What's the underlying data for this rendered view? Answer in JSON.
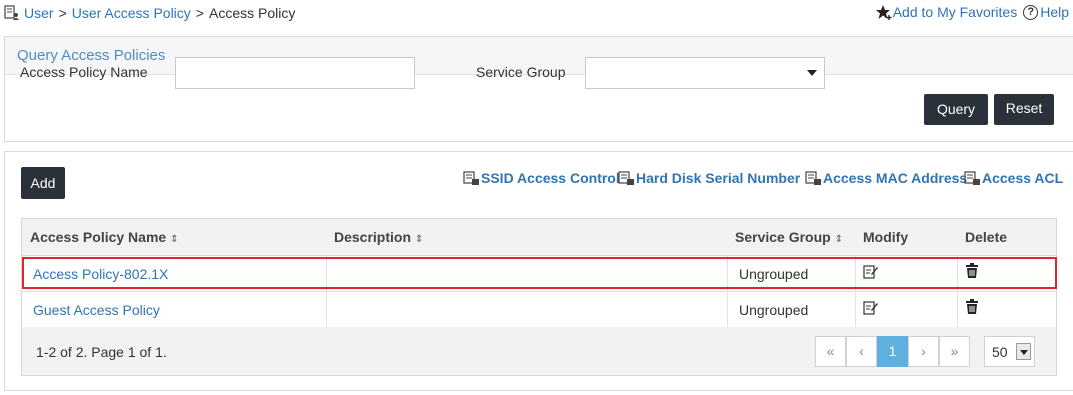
{
  "breadcrumb": {
    "items": [
      "User",
      "User Access Policy",
      "Access Policy"
    ],
    "separator": ">"
  },
  "toplinks": {
    "favorites": "Add to My Favorites",
    "help": "Help"
  },
  "query": {
    "title": "Query Access Policies",
    "name_label": "Access Policy Name",
    "name_value": "",
    "group_label": "Service Group",
    "group_value": "",
    "query_button": "Query",
    "reset_button": "Reset"
  },
  "toolbar": {
    "add_button": "Add",
    "links": [
      "SSID Access Control",
      "Hard Disk Serial Number",
      "Access MAC Address",
      "Access ACL"
    ]
  },
  "table": {
    "columns": [
      "Access Policy Name",
      "Description",
      "Service Group",
      "Modify",
      "Delete"
    ],
    "sort_glyph": "⇕",
    "rows": [
      {
        "name": "Access Policy-802.1X",
        "description": "",
        "service_group": "Ungrouped"
      },
      {
        "name": "Guest Access Policy",
        "description": "",
        "service_group": "Ungrouped"
      }
    ]
  },
  "pagination": {
    "info": "1-2 of 2. Page 1 of 1.",
    "first": "«",
    "prev": "‹",
    "current": "1",
    "next": "›",
    "last": "»",
    "page_size": "50"
  },
  "colors": {
    "link": "#2f74b5",
    "dark_button": "#2b313a",
    "active_page": "#5fb0de",
    "highlight": "#e0262b"
  }
}
